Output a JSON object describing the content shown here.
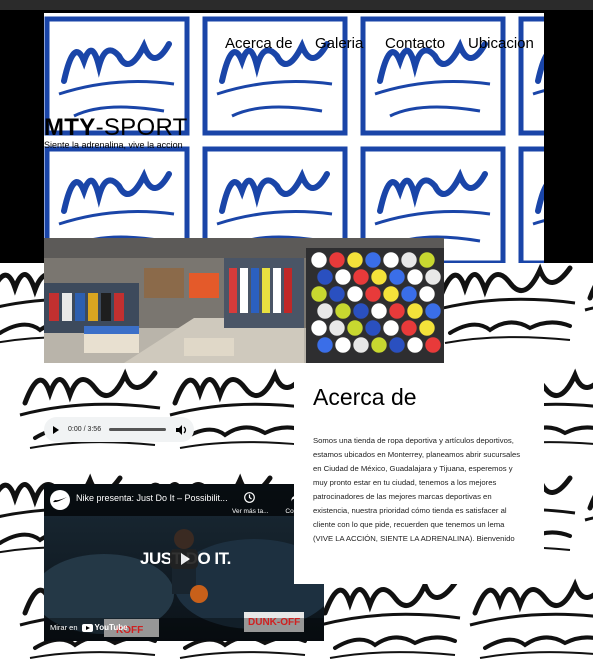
{
  "site": {
    "brand_bold": "MTY",
    "brand_rest": "-SPORT",
    "tagline": "Siente la adrenalina, vive la accion",
    "logo_text": "MTY SPORT"
  },
  "nav": {
    "items": [
      {
        "label": "Acerca de"
      },
      {
        "label": "Galeria"
      },
      {
        "label": "Contacto"
      },
      {
        "label": "Ubicacion"
      }
    ]
  },
  "audio": {
    "time": "0:00 / 3:56"
  },
  "video": {
    "title": "Nike presenta: Just Do It – Possibilit...",
    "watch_later": "Ver más ta...",
    "share": "Com...",
    "overlay_text": "JUST DO IT.",
    "watch_on": "Mirar en",
    "youtube": "YouTube",
    "brand": "KOFF",
    "sign": "DUNK-OFF"
  },
  "about": {
    "heading": "Acerca de",
    "body": "Somos una tienda de ropa deportiva y artículos deportivos, estamos ubicados en Monterrey, planeamos abrir sucursales en Ciudad de México, Guadalajara y Tijuana, esperemos y muy pronto estar en tu ciudad, tenemos a los mejores patrocinadores de las mejores marcas deportivas en existencia, nuestra prioridad cómo tienda es satisfacer al cliente con lo que pide, recuerden que tenemos un lema (VIVE LA ACCIÓN, SIENTE LA ADRENALINA). Bienvenido"
  },
  "colors": {
    "logo_blue": "#1a45a8",
    "page_black": "#000000",
    "text": "#222222"
  }
}
